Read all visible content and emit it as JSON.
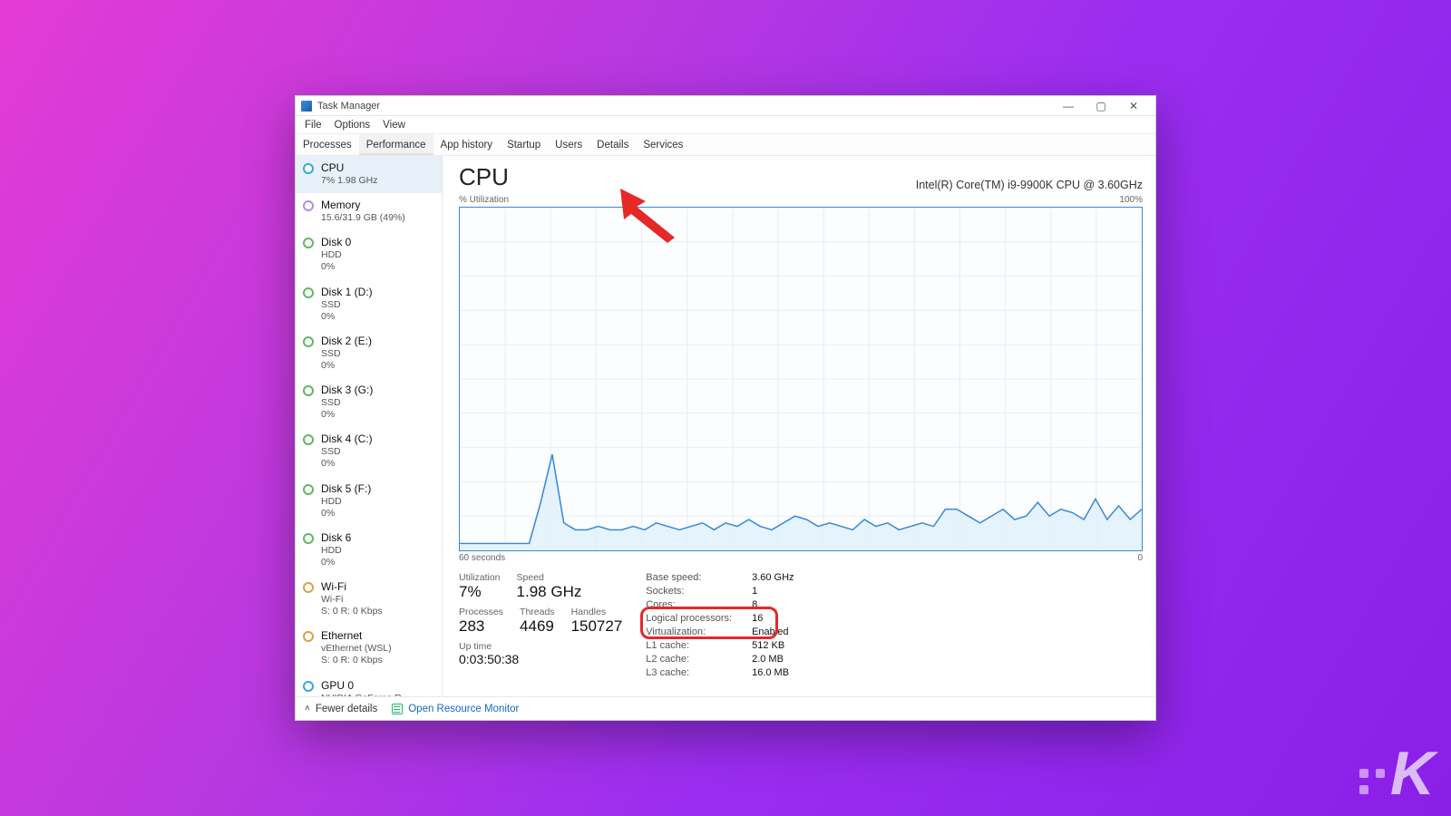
{
  "window": {
    "title": "Task Manager",
    "controls": {
      "min": "—",
      "max": "▢",
      "close": "✕"
    }
  },
  "menubar": [
    "File",
    "Options",
    "View"
  ],
  "tabs": [
    "Processes",
    "Performance",
    "App history",
    "Startup",
    "Users",
    "Details",
    "Services"
  ],
  "active_tab": 1,
  "sidebar": [
    {
      "kind": "cpu",
      "title": "CPU",
      "sub": "7%  1.98 GHz",
      "selected": true
    },
    {
      "kind": "mem",
      "title": "Memory",
      "sub": "15.6/31.9 GB (49%)"
    },
    {
      "kind": "disk-green",
      "title": "Disk 0",
      "sub": "HDD\n0%"
    },
    {
      "kind": "disk-green",
      "title": "Disk 1 (D:)",
      "sub": "SSD\n0%"
    },
    {
      "kind": "disk-green",
      "title": "Disk 2 (E:)",
      "sub": "SSD\n0%"
    },
    {
      "kind": "disk-green",
      "title": "Disk 3 (G:)",
      "sub": "SSD\n0%"
    },
    {
      "kind": "disk-green",
      "title": "Disk 4 (C:)",
      "sub": "SSD\n0%"
    },
    {
      "kind": "disk-green",
      "title": "Disk 5 (F:)",
      "sub": "HDD\n0%"
    },
    {
      "kind": "disk-green",
      "title": "Disk 6",
      "sub": "HDD\n0%"
    },
    {
      "kind": "net",
      "title": "Wi-Fi",
      "sub": "Wi-Fi\nS: 0 R: 0 Kbps"
    },
    {
      "kind": "net",
      "title": "Ethernet",
      "sub": "vEthernet (WSL)\nS: 0 R: 0 Kbps"
    },
    {
      "kind": "gpu",
      "title": "GPU 0",
      "sub": "NVIDIA GeForce R..."
    }
  ],
  "main": {
    "heading": "CPU",
    "model": "Intel(R) Core(TM) i9-9900K CPU @ 3.60GHz",
    "chart_top_left": "% Utilization",
    "chart_top_right": "100%",
    "chart_bottom_left": "60 seconds",
    "chart_bottom_right": "0",
    "stats_left": {
      "utilization": {
        "lbl": "Utilization",
        "val": "7%"
      },
      "speed": {
        "lbl": "Speed",
        "val": "1.98 GHz"
      },
      "processes": {
        "lbl": "Processes",
        "val": "283"
      },
      "threads": {
        "lbl": "Threads",
        "val": "4469"
      },
      "handles": {
        "lbl": "Handles",
        "val": "150727"
      },
      "uptime": {
        "lbl": "Up time",
        "val": "0:03:50:38"
      }
    },
    "stats_right": [
      {
        "k": "Base speed:",
        "v": "3.60 GHz"
      },
      {
        "k": "Sockets:",
        "v": "1"
      },
      {
        "k": "Cores:",
        "v": "8"
      },
      {
        "k": "Logical processors:",
        "v": "16"
      },
      {
        "k": "Virtualization:",
        "v": "Enabled"
      },
      {
        "k": "L1 cache:",
        "v": "512 KB"
      },
      {
        "k": "L2 cache:",
        "v": "2.0 MB"
      },
      {
        "k": "L3 cache:",
        "v": "16.0 MB"
      }
    ]
  },
  "footer": {
    "fewer": "Fewer details",
    "orm": "Open Resource Monitor"
  },
  "chart_data": {
    "type": "line",
    "title": "% Utilization",
    "xlabel": "60 seconds → 0",
    "ylabel": "% Utilization",
    "ylim": [
      0,
      100
    ],
    "x": [
      0,
      1,
      2,
      3,
      4,
      5,
      6,
      7,
      8,
      9,
      10,
      11,
      12,
      13,
      14,
      15,
      16,
      17,
      18,
      19,
      20,
      21,
      22,
      23,
      24,
      25,
      26,
      27,
      28,
      29,
      30,
      31,
      32,
      33,
      34,
      35,
      36,
      37,
      38,
      39,
      40,
      41,
      42,
      43,
      44,
      45,
      46,
      47,
      48,
      49,
      50,
      51,
      52,
      53,
      54,
      55,
      56,
      57,
      58,
      59
    ],
    "values": [
      2,
      2,
      2,
      2,
      2,
      2,
      2,
      14,
      28,
      8,
      6,
      6,
      7,
      6,
      6,
      7,
      6,
      8,
      7,
      6,
      7,
      8,
      6,
      8,
      7,
      9,
      7,
      6,
      8,
      10,
      9,
      7,
      8,
      7,
      6,
      9,
      7,
      8,
      6,
      7,
      8,
      7,
      12,
      12,
      10,
      8,
      10,
      12,
      9,
      10,
      14,
      10,
      12,
      11,
      9,
      15,
      9,
      13,
      9,
      12
    ]
  }
}
